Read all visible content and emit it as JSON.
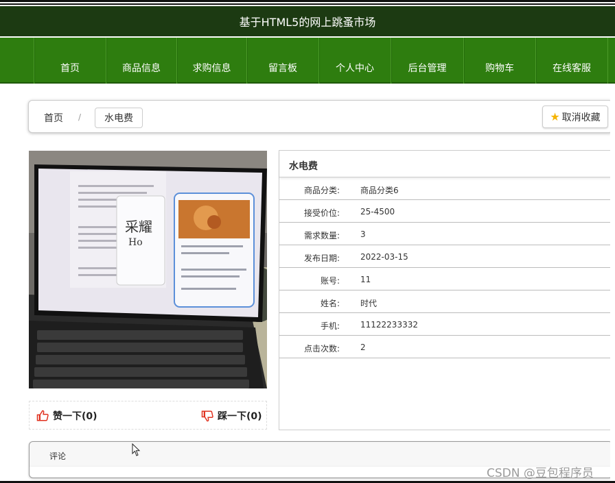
{
  "site_title": "基于HTML5的网上跳蚤市场",
  "nav": [
    {
      "label": "首页"
    },
    {
      "label": "商品信息"
    },
    {
      "label": "求购信息"
    },
    {
      "label": "留言板"
    },
    {
      "label": "个人中心"
    },
    {
      "label": "后台管理"
    },
    {
      "label": "购物车"
    },
    {
      "label": "在线客服"
    }
  ],
  "breadcrumb": {
    "home": "首页",
    "separator": "/",
    "current": "水电费"
  },
  "favorite_button": {
    "label": "取消收藏",
    "icon": "star-icon"
  },
  "product": {
    "name": "水电费",
    "fields": [
      {
        "key": "商品分类:",
        "value": "商品分类6"
      },
      {
        "key": "接受价位:",
        "value": "25-4500"
      },
      {
        "key": "需求数量:",
        "value": "3"
      },
      {
        "key": "发布日期:",
        "value": "2022-03-15"
      },
      {
        "key": "账号:",
        "value": "11"
      },
      {
        "key": "姓名:",
        "value": "时代"
      },
      {
        "key": "手机:",
        "value": "11122233332"
      },
      {
        "key": "点击次数:",
        "value": "2"
      }
    ]
  },
  "votes": {
    "like_label": "赞一下(0)",
    "dislike_label": "踩一下(0)"
  },
  "comments": {
    "label": "评论"
  },
  "watermark": "CSDN @豆包程序员",
  "colors": {
    "title_bg": "#1c3a12",
    "nav_bg": "#2e7d0f",
    "like_icon": "#e0301e"
  }
}
